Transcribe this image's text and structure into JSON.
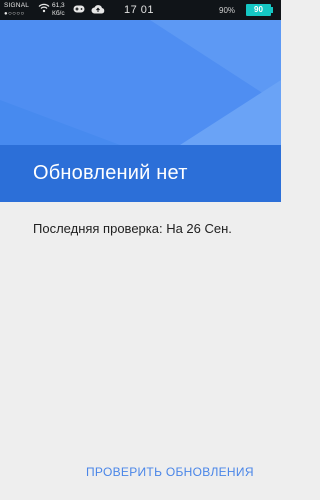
{
  "status_bar": {
    "signal_label": "SIGNAL",
    "signal_dots": "●○○○○",
    "net_rate_value": "61,3",
    "net_rate_unit": "Кб/с",
    "time": "17 01",
    "battery_percent": "90%",
    "battery_level": "90"
  },
  "hero": {
    "colors": {
      "base": "#4f8ef2",
      "light": "#6aa3f6",
      "dark": "#2c6fd8"
    }
  },
  "title": "Обновлений нет",
  "last_check": "Последняя проверка: На 26 Сен.",
  "check_button": "ПРОВЕРИТЬ ОБНОВЛЕНИЯ"
}
